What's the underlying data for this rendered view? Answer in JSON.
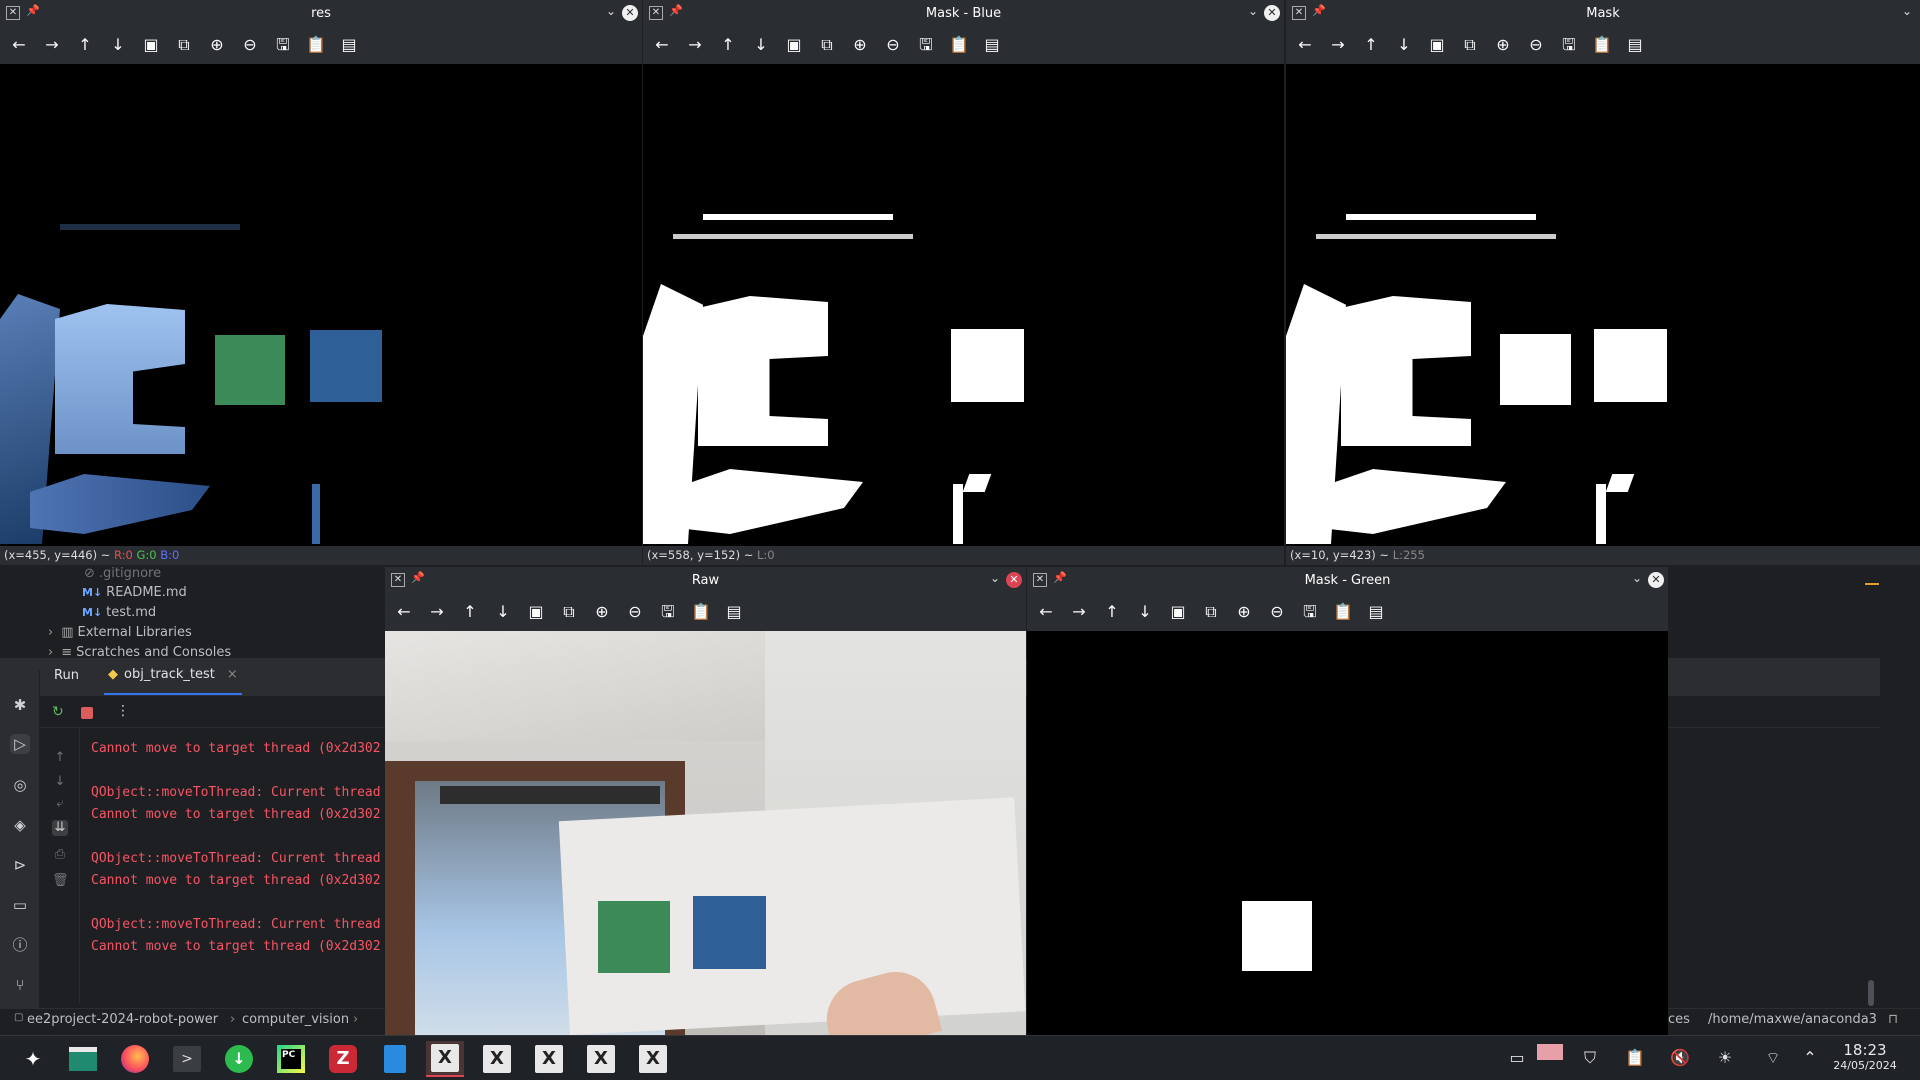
{
  "ide": {
    "tree": [
      {
        "label": ".gitignore",
        "type": "file"
      },
      {
        "label": "README.md",
        "type": "md"
      },
      {
        "label": "test.md",
        "type": "md"
      },
      {
        "label": "External Libraries",
        "type": "folder"
      },
      {
        "label": "Scratches and Consoles",
        "type": "folder"
      }
    ],
    "run_tab": "Run",
    "run_config": "obj_track_test",
    "console": [
      "Cannot move to target thread (0x2d302",
      "",
      "QObject::moveToThread: Current thread",
      "Cannot move to target thread (0x2d302",
      "",
      "QObject::moveToThread: Current thread",
      "Cannot move to target thread (0x2d302",
      "",
      "QObject::moveToThread: Current thread",
      "Cannot move to target thread (0x2d302"
    ],
    "breadcrumb": [
      "ee2project-2024-robot-power",
      "computer_vision"
    ],
    "status_right_fragment": "ces",
    "interpreter_path": "/home/maxwe/anaconda3"
  },
  "windows": {
    "res": {
      "title": "res",
      "status_coords": "(x=455, y=446) ~",
      "status_r": "R:0",
      "status_g": "G:0",
      "status_b": "B:0"
    },
    "mask_blue": {
      "title": "Mask - Blue",
      "status_coords": "(x=558, y=152) ~",
      "status_l": "L:0"
    },
    "mask": {
      "title": "Mask",
      "status_coords": "(x=10, y=423) ~",
      "status_l": "L:255"
    },
    "raw": {
      "title": "Raw"
    },
    "mask_green": {
      "title": "Mask - Green"
    }
  },
  "toolbar_icons": [
    "arrow-left-icon",
    "arrow-right-icon",
    "arrow-up-icon",
    "arrow-down-icon",
    "image-icon",
    "image-export-icon",
    "zoom-in-icon",
    "zoom-out-icon",
    "save-icon",
    "clipboard-icon",
    "properties-icon"
  ],
  "taskbar": {
    "clock_time": "18:23",
    "clock_date": "24/05/2024"
  },
  "colors": {
    "green_square": "#3c8a57",
    "blue_square": "#2f5f97",
    "console_error": "#f75464",
    "accent": "#da4453"
  }
}
